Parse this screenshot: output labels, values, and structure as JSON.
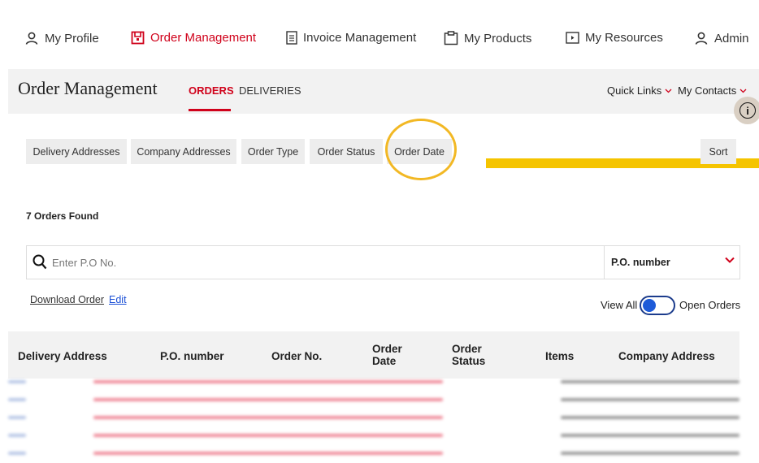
{
  "nav": {
    "items": [
      {
        "label": "My Profile",
        "icon": "person-icon"
      },
      {
        "label": "Order Management",
        "icon": "order-icon",
        "active": true
      },
      {
        "label": "Invoice Management",
        "icon": "document-icon"
      },
      {
        "label": "My Products",
        "icon": "clipboard-icon"
      },
      {
        "label": "My Resources",
        "icon": "play-box-icon"
      },
      {
        "label": "Admin",
        "icon": "person-icon"
      }
    ]
  },
  "header": {
    "title": "Order Management",
    "tabs": [
      {
        "label": "ORDERS",
        "active": true
      },
      {
        "label": "DELIVERIES"
      }
    ],
    "quick_links": "Quick Links",
    "my_contacts": "My Contacts"
  },
  "filters": {
    "chips": [
      "Delivery Addresses",
      "Company Addresses",
      "Order Type",
      "Order Status",
      "Order Date"
    ],
    "sort": "Sort"
  },
  "results": {
    "count_text": "7 Orders Found"
  },
  "search": {
    "placeholder": "Enter P.O No.",
    "field_selected": "P.O. number"
  },
  "actions": {
    "download": "Download Order",
    "edit": "Edit"
  },
  "toggle": {
    "left_label": "View All",
    "right_label": "Open Orders"
  },
  "table": {
    "columns": [
      {
        "label": "Delivery Address"
      },
      {
        "label": "P.O. number"
      },
      {
        "label": "Order No."
      },
      {
        "line1": "Order",
        "line2": "Date"
      },
      {
        "line1": "Order",
        "line2": "Status"
      },
      {
        "label": "Items"
      },
      {
        "label": "Company Address"
      }
    ]
  },
  "colors": {
    "accent_red": "#d0021b",
    "highlight_yellow": "#f5c400",
    "toggle_blue": "#1e5bd8"
  }
}
